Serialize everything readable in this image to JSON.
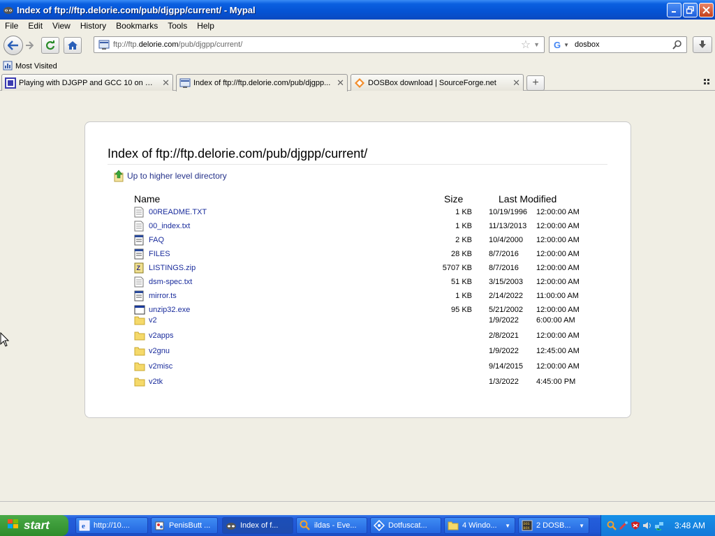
{
  "window": {
    "title": "Index of ftp://ftp.delorie.com/pub/djgpp/current/ - Mypal",
    "app_icon": "mypal-raccoon-icon"
  },
  "menu": {
    "items": [
      {
        "label": "File"
      },
      {
        "label": "Edit"
      },
      {
        "label": "View"
      },
      {
        "label": "History"
      },
      {
        "label": "Bookmarks"
      },
      {
        "label": "Tools"
      },
      {
        "label": "Help"
      }
    ]
  },
  "nav": {
    "url_prefix": "ftp://ftp.",
    "url_domain": "delorie.com",
    "url_suffix": "/pub/djgpp/current/",
    "search_value": "dosbox"
  },
  "bookmarks": {
    "most_visited": "Most Visited"
  },
  "tabs": [
    {
      "label": "Playing with DJGPP and GCC 10 on DOS |...",
      "icon": "page-icon"
    },
    {
      "label": "Index of ftp://ftp.delorie.com/pub/djgpp...",
      "icon": "ftp-page-icon",
      "active": true
    },
    {
      "label": "DOSBox download | SourceForge.net",
      "icon": "sourceforge-icon"
    }
  ],
  "page": {
    "heading": "Index of ftp://ftp.delorie.com/pub/djgpp/current/",
    "up_link": "Up to higher level directory",
    "columns": {
      "name": "Name",
      "size": "Size",
      "modified": "Last Modified"
    },
    "files": [
      {
        "name": "00README.TXT",
        "size": "1 KB",
        "date": "10/19/1996",
        "time": "12:00:00 AM",
        "icon": "text-file-icon"
      },
      {
        "name": "00_index.txt",
        "size": "1 KB",
        "date": "11/13/2013",
        "time": "12:00:00 AM",
        "icon": "text-file-icon"
      },
      {
        "name": "FAQ",
        "size": "2 KB",
        "date": "10/4/2000",
        "time": "12:00:00 AM",
        "icon": "generic-file-icon"
      },
      {
        "name": "FILES",
        "size": "28 KB",
        "date": "8/7/2016",
        "time": "12:00:00 AM",
        "icon": "generic-file-icon"
      },
      {
        "name": "LISTINGS.zip",
        "size": "5707 KB",
        "date": "8/7/2016",
        "time": "12:00:00 AM",
        "icon": "zip-file-icon"
      },
      {
        "name": "dsm-spec.txt",
        "size": "51 KB",
        "date": "3/15/2003",
        "time": "12:00:00 AM",
        "icon": "text-file-icon"
      },
      {
        "name": "mirror.ts",
        "size": "1 KB",
        "date": "2/14/2022",
        "time": "11:00:00 AM",
        "icon": "generic-file-icon"
      },
      {
        "name": "unzip32.exe",
        "size": "95 KB",
        "date": "5/21/2002",
        "time": "12:00:00 AM",
        "icon": "exe-file-icon"
      },
      {
        "name": "v2",
        "size": "",
        "date": "1/9/2022",
        "time": "6:00:00 AM",
        "icon": "folder-icon"
      },
      {
        "name": "v2apps",
        "size": "",
        "date": "2/8/2021",
        "time": "12:00:00 AM",
        "icon": "folder-icon"
      },
      {
        "name": "v2gnu",
        "size": "",
        "date": "1/9/2022",
        "time": "12:45:00 AM",
        "icon": "folder-icon"
      },
      {
        "name": "v2misc",
        "size": "",
        "date": "9/14/2015",
        "time": "12:00:00 AM",
        "icon": "folder-icon"
      },
      {
        "name": "v2tk",
        "size": "",
        "date": "1/3/2022",
        "time": "4:45:00 PM",
        "icon": "folder-icon"
      }
    ]
  },
  "taskbar": {
    "start_label": "start",
    "tasks": [
      {
        "label": "http://10....",
        "icon": "ie-icon"
      },
      {
        "label": "PenisButt ...",
        "icon": "paint-icon"
      },
      {
        "label": "Index of f...",
        "icon": "mypal-raccoon-icon",
        "active": true
      },
      {
        "label": "ildas - Eve...",
        "icon": "search-icon"
      },
      {
        "label": "Dotfuscat...",
        "icon": "dotfuscator-icon"
      },
      {
        "label": "4 Windo...",
        "icon": "folder-icon",
        "grouped": true
      },
      {
        "label": "2 DOSB...",
        "icon": "dosbox-icon",
        "grouped": true
      }
    ],
    "clock": "3:48 AM"
  }
}
